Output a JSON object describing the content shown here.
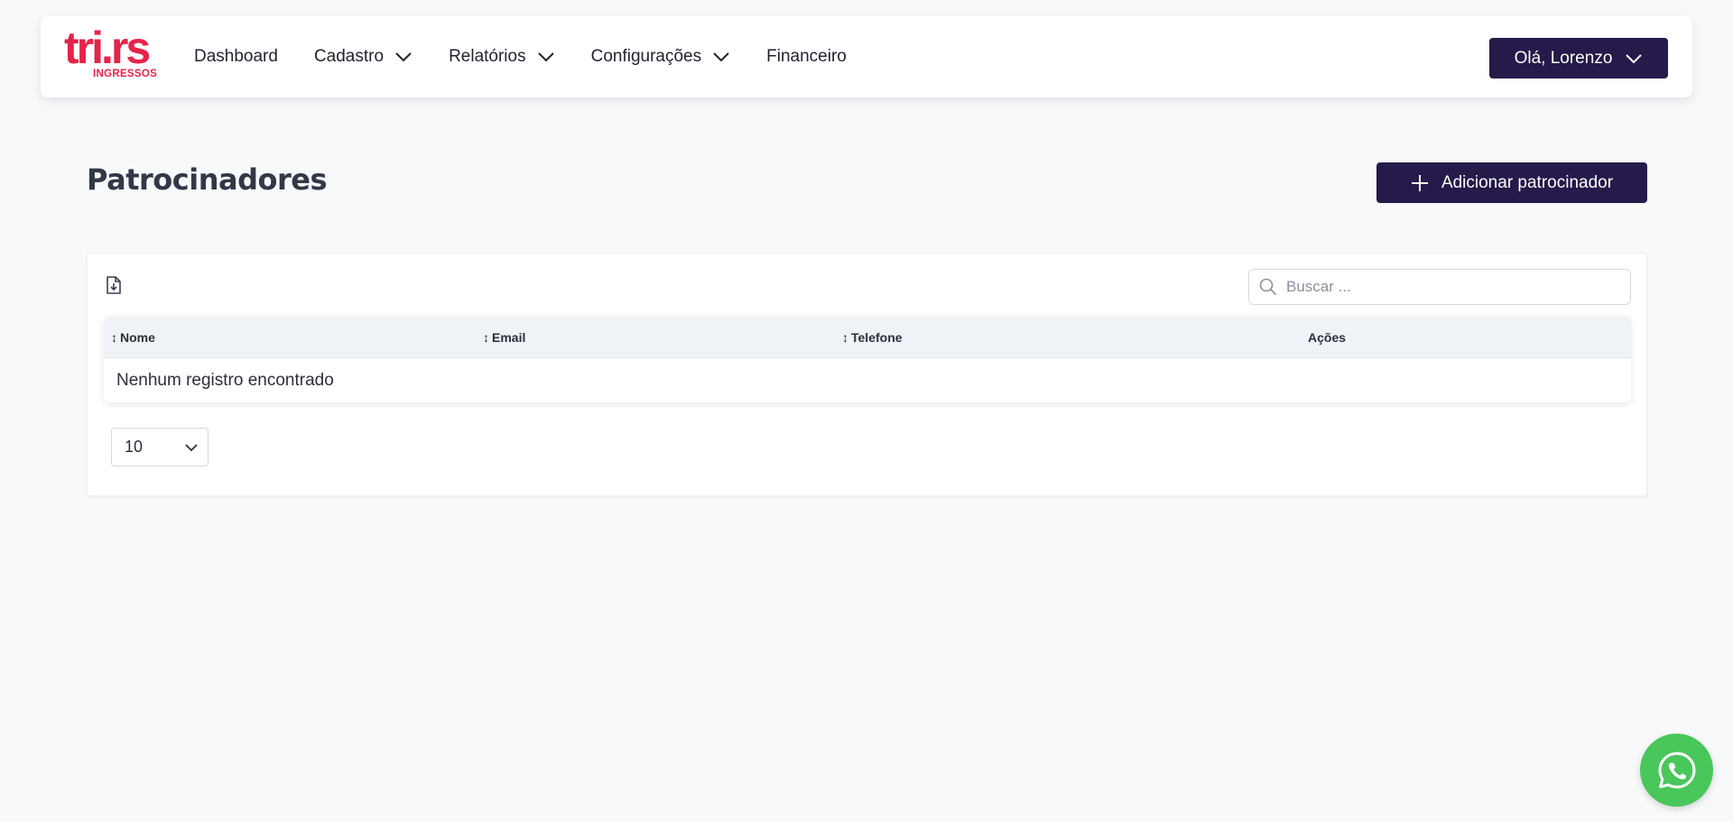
{
  "brand": {
    "logo_text": "tri.rs",
    "logo_subtext": "INGRESSOS",
    "color": "#e6234a"
  },
  "nav": {
    "items": [
      {
        "label": "Dashboard",
        "has_dropdown": false
      },
      {
        "label": "Cadastro",
        "has_dropdown": true
      },
      {
        "label": "Relatórios",
        "has_dropdown": true
      },
      {
        "label": "Configurações",
        "has_dropdown": true
      },
      {
        "label": "Financeiro",
        "has_dropdown": false
      }
    ],
    "user_label": "Olá, Lorenzo"
  },
  "page": {
    "title": "Patrocinadores",
    "add_button_label": "Adicionar patrocinador",
    "accent_color": "#261a4a"
  },
  "toolbar": {
    "export_icon": "file-download-icon",
    "search_placeholder": "Buscar ...",
    "search_value": ""
  },
  "table": {
    "columns": [
      {
        "label": "Nome",
        "sortable": true
      },
      {
        "label": "Email",
        "sortable": true
      },
      {
        "label": "Telefone",
        "sortable": true
      },
      {
        "label": "Ações",
        "sortable": false
      }
    ],
    "rows": [],
    "empty_message": "Nenhum registro encontrado",
    "sort_glyph": "↕"
  },
  "pagination": {
    "page_size": "10"
  },
  "whatsapp": {
    "icon": "whatsapp-icon",
    "color": "#49c75b"
  }
}
